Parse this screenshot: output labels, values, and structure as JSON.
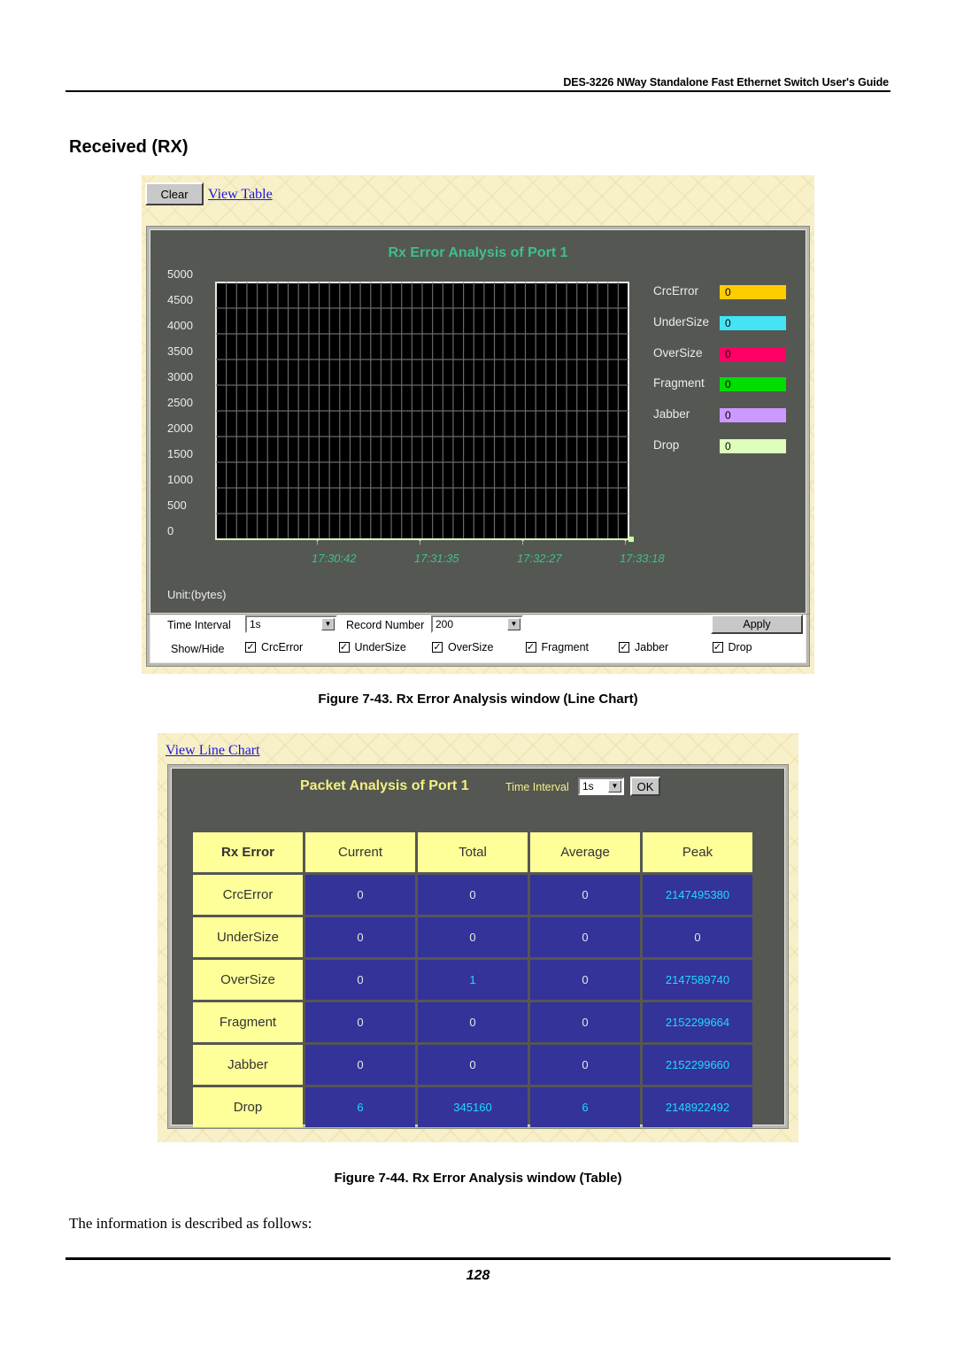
{
  "header": {
    "guide_title": "DES-3226 NWay Standalone Fast Ethernet Switch User's Guide"
  },
  "section_title": "Received (RX)",
  "figure1": {
    "clear_label": "Clear",
    "view_table_label": "View Table",
    "caption": "Figure 7-43.  Rx Error Analysis window (Line Chart)",
    "unit_label": "Unit:(bytes)",
    "controls": {
      "time_interval_label": "Time Interval",
      "time_interval_value": "1s",
      "record_number_label": "Record Number",
      "record_number_value": "200",
      "apply_label": "Apply",
      "show_hide_label": "Show/Hide",
      "checkboxes": [
        {
          "label": "CrcError",
          "checked": true
        },
        {
          "label": "UnderSize",
          "checked": true
        },
        {
          "label": "OverSize",
          "checked": true
        },
        {
          "label": "Fragment",
          "checked": true
        },
        {
          "label": "Jabber",
          "checked": true
        },
        {
          "label": "Drop",
          "checked": true
        }
      ]
    }
  },
  "chart_data": {
    "type": "line",
    "title": "Rx Error Analysis of Port 1",
    "ylabel": "Unit:(bytes)",
    "xlabel": "",
    "ylim": [
      0,
      5000
    ],
    "yticks": [
      "5000",
      "4500",
      "4000",
      "3500",
      "3000",
      "2500",
      "2000",
      "1500",
      "1000",
      "500",
      "0"
    ],
    "xticks": [
      "17:30:42",
      "17:31:35",
      "17:32:27",
      "17:33:18"
    ],
    "grid": true,
    "legend_position": "right",
    "series": [
      {
        "name": "CrcError",
        "color": "#ffcc00",
        "current": 0,
        "values": [
          0,
          0,
          0,
          0
        ]
      },
      {
        "name": "UnderSize",
        "color": "#44e4f4",
        "current": 0,
        "values": [
          0,
          0,
          0,
          0
        ]
      },
      {
        "name": "OverSize",
        "color": "#ff0066",
        "current": 0,
        "values": [
          0,
          0,
          0,
          0
        ]
      },
      {
        "name": "Fragment",
        "color": "#00dd00",
        "current": 0,
        "values": [
          0,
          0,
          0,
          0
        ]
      },
      {
        "name": "Jabber",
        "color": "#cc99ff",
        "current": 0,
        "values": [
          0,
          0,
          0,
          0
        ]
      },
      {
        "name": "Drop",
        "color": "#ddffbb",
        "current": 0,
        "values": [
          0,
          0,
          0,
          0
        ]
      }
    ]
  },
  "figure2": {
    "view_line_chart_label": "View Line Chart",
    "title": "Packet Analysis of Port 1",
    "time_interval_label": "Time Interval",
    "time_interval_value": "1s",
    "ok_label": "OK",
    "columns": [
      "Rx Error",
      "Current",
      "Total",
      "Average",
      "Peak"
    ],
    "rows": [
      {
        "name": "CrcError",
        "values": [
          "0",
          "0",
          "0",
          "2147495380"
        ],
        "highlight": [
          false,
          false,
          false,
          true
        ]
      },
      {
        "name": "UnderSize",
        "values": [
          "0",
          "0",
          "0",
          "0"
        ],
        "highlight": [
          false,
          false,
          false,
          false
        ]
      },
      {
        "name": "OverSize",
        "values": [
          "0",
          "1",
          "0",
          "2147589740"
        ],
        "highlight": [
          false,
          true,
          false,
          true
        ]
      },
      {
        "name": "Fragment",
        "values": [
          "0",
          "0",
          "0",
          "2152299664"
        ],
        "highlight": [
          false,
          false,
          false,
          true
        ]
      },
      {
        "name": "Jabber",
        "values": [
          "0",
          "0",
          "0",
          "2152299660"
        ],
        "highlight": [
          false,
          false,
          false,
          true
        ]
      },
      {
        "name": "Drop",
        "values": [
          "6",
          "345160",
          "6",
          "2148922492"
        ],
        "highlight": [
          true,
          true,
          true,
          true
        ]
      }
    ],
    "caption": "Figure 7-44.  Rx Error Analysis window (Table)"
  },
  "body_text": "The information is described as follows:",
  "footer": {
    "page_number": "128"
  }
}
